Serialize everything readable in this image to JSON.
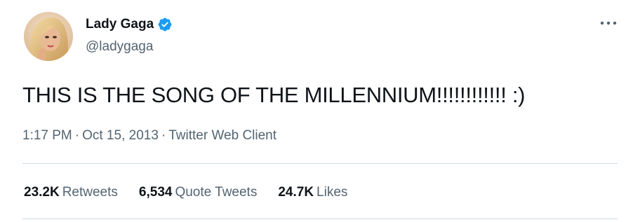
{
  "tweet": {
    "author": {
      "display_name": "Lady Gaga",
      "handle": "@ladygaga",
      "verified": true,
      "verified_color": "#1d9bf0"
    },
    "text": "THIS IS THE SONG OF THE MILLENNIUM!!!!!!!!!!!! :)",
    "meta": {
      "time": "1:17 PM",
      "separator": "·",
      "date": "Oct 15, 2013",
      "client": "Twitter Web Client"
    },
    "stats": {
      "retweets": {
        "count": "23.2K",
        "label": "Retweets"
      },
      "quote_tweets": {
        "count": "6,534",
        "label": "Quote Tweets"
      },
      "likes": {
        "count": "24.7K",
        "label": "Likes"
      }
    },
    "more_icon": "ellipsis-icon"
  }
}
